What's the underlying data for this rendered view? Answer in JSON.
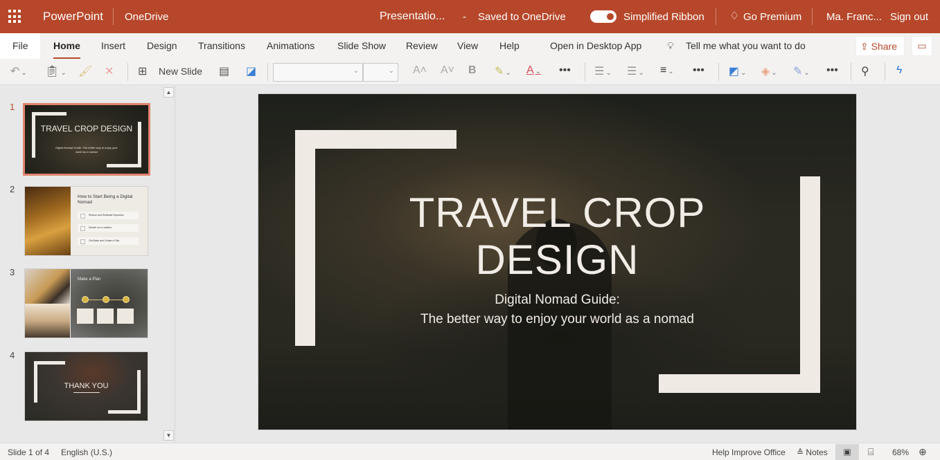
{
  "titlebar": {
    "app_name": "PowerPoint",
    "location": "OneDrive",
    "document_name": "Presentatio...",
    "separator": "-",
    "save_status": "Saved to OneDrive",
    "simplified_ribbon_label": "Simplified Ribbon",
    "simplified_ribbon_on": true,
    "premium_label": "Go Premium",
    "user_name": "Ma. Franc...",
    "sign_out_label": "Sign out",
    "brand_color": "#b7472a"
  },
  "tabs": {
    "file": "File",
    "items": [
      "Home",
      "Insert",
      "Design",
      "Transitions",
      "Animations",
      "Slide Show",
      "Review",
      "View",
      "Help",
      "Open in Desktop App"
    ],
    "active": "Home",
    "tell_me": "Tell me what you want to do",
    "share_label": "Share"
  },
  "ribbon": {
    "new_slide_label": "New Slide",
    "font_name": "",
    "font_size": "",
    "icons": [
      "undo-icon",
      "paste-icon",
      "format-painter-icon",
      "delete-icon",
      "new-slide-icon",
      "layout-icon",
      "design-background-icon",
      "grow-font-icon",
      "shrink-font-icon",
      "bold-icon",
      "highlight-icon",
      "font-color-icon",
      "more-icon",
      "bullets-icon",
      "numbering-icon",
      "align-icon",
      "more-icon",
      "shapes-icon",
      "shape-fill-icon",
      "shape-outline-icon",
      "more-icon",
      "search-icon",
      "lightning-icon"
    ]
  },
  "thumbnails": [
    {
      "number": "1",
      "title": "TRAVEL CROP DESIGN",
      "subtitle": "Digital Nomad Guide: The better way to enjoy your world as a nomad",
      "active": true
    },
    {
      "number": "2",
      "title": "How to Start Being a Digital Nomad",
      "items": [
        "Reduce and Eliminate Expenses",
        "Decide on a Location",
        "Get Basic and Create a Plan"
      ],
      "active": false
    },
    {
      "number": "3",
      "title": "Make a Plan",
      "steps": [
        "1",
        "2",
        "3"
      ],
      "active": false
    },
    {
      "number": "4",
      "title": "THANK YOU",
      "active": false
    }
  ],
  "slide": {
    "title_line1": "TRAVEL CROP",
    "title_line2": "DESIGN",
    "subtitle_line1": "Digital Nomad Guide:",
    "subtitle_line2": "The better way to enjoy your world as a nomad"
  },
  "statusbar": {
    "slide_position": "Slide 1 of 4",
    "language": "English (U.S.)",
    "help_improve": "Help Improve Office",
    "notes_label": "Notes",
    "zoom": "68%"
  }
}
